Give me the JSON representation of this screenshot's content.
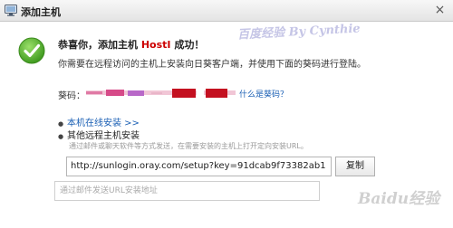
{
  "window": {
    "title": "添加主机",
    "close_glyph": "×"
  },
  "success": {
    "icon": "checkmark-circle-icon",
    "headline_prefix": "恭喜你，添加主机 ",
    "host_name": "HostI",
    "headline_suffix": " 成功！",
    "subtitle": "你需要在远程访问的主机上安装向日葵客户端，并使用下面的葵码进行登陆。"
  },
  "key": {
    "label": "葵码：",
    "help_link": "什么是葵码？"
  },
  "install": {
    "online_label": "本机在线安装 >>",
    "other_label": "其他远程主机安装",
    "hint": "通过邮件或聊天软件等方式发送，在需要安装的主机上打开定向安装URL。",
    "url_value": "http://sunlogin.oray.com/setup?key=91dcab9f73382ab1",
    "copy_label": "复制",
    "email_placeholder": "通过邮件发送URL安装地址"
  },
  "watermarks": {
    "top": "百度经验 By Cynthie",
    "bottom": "Baidu经验"
  },
  "colors": {
    "link": "#1a5fb4",
    "host": "#cc0000",
    "success": "#4caf2a"
  }
}
